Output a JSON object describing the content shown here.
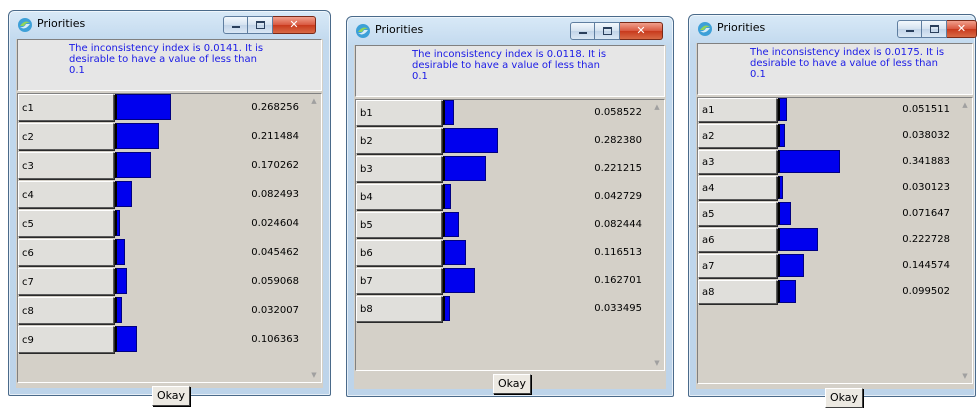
{
  "windows": [
    {
      "title": "Priorities",
      "message": "The inconsistency index is 0.0141.  It is\ndesirable to have a value of less than\n0.1",
      "ok_label": "Okay",
      "close_glyph": "✕",
      "items": [
        {
          "label": "c1",
          "value": "0.268256",
          "weight": 0.268256
        },
        {
          "label": "c2",
          "value": "0.211484",
          "weight": 0.211484
        },
        {
          "label": "c3",
          "value": "0.170262",
          "weight": 0.170262
        },
        {
          "label": "c4",
          "value": "0.082493",
          "weight": 0.082493
        },
        {
          "label": "c5",
          "value": "0.024604",
          "weight": 0.024604
        },
        {
          "label": "c6",
          "value": "0.045462",
          "weight": 0.045462
        },
        {
          "label": "c7",
          "value": "0.059068",
          "weight": 0.059068
        },
        {
          "label": "c8",
          "value": "0.032007",
          "weight": 0.032007
        },
        {
          "label": "c9",
          "value": "0.106363",
          "weight": 0.106363
        }
      ]
    },
    {
      "title": "Priorities",
      "message": "The inconsistency index is 0.0118.  It is\ndesirable to have a value of less than\n0.1",
      "ok_label": "Okay",
      "close_glyph": "✕",
      "items": [
        {
          "label": "b1",
          "value": "0.058522",
          "weight": 0.058522
        },
        {
          "label": "b2",
          "value": "0.282380",
          "weight": 0.28238
        },
        {
          "label": "b3",
          "value": "0.221215",
          "weight": 0.221215
        },
        {
          "label": "b4",
          "value": "0.042729",
          "weight": 0.042729
        },
        {
          "label": "b5",
          "value": "0.082444",
          "weight": 0.082444
        },
        {
          "label": "b6",
          "value": "0.116513",
          "weight": 0.116513
        },
        {
          "label": "b7",
          "value": "0.162701",
          "weight": 0.162701
        },
        {
          "label": "b8",
          "value": "0.033495",
          "weight": 0.033495
        }
      ]
    },
    {
      "title": "Priorities",
      "message": "The inconsistency index is 0.0175.  It is\ndesirable to have a value of less than\n0.1",
      "ok_label": "Okay",
      "close_glyph": "✕",
      "items": [
        {
          "label": "a1",
          "value": "0.051511",
          "weight": 0.051511
        },
        {
          "label": "a2",
          "value": "0.038032",
          "weight": 0.038032
        },
        {
          "label": "a3",
          "value": "0.341883",
          "weight": 0.341883
        },
        {
          "label": "a4",
          "value": "0.030123",
          "weight": 0.030123
        },
        {
          "label": "a5",
          "value": "0.071647",
          "weight": 0.071647
        },
        {
          "label": "a6",
          "value": "0.222728",
          "weight": 0.222728
        },
        {
          "label": "a7",
          "value": "0.144574",
          "weight": 0.144574
        },
        {
          "label": "a8",
          "value": "0.099502",
          "weight": 0.099502
        }
      ]
    }
  ],
  "colors": {
    "bar_fill": "#0000ee",
    "message_text": "#1a1ae6",
    "panel": "#d4d0c8"
  },
  "icons": {
    "app": "app-logo-icon",
    "minimize": "minimize-icon",
    "maximize": "maximize-icon",
    "close": "close-icon",
    "scroll_up": "scroll-up-arrow-icon",
    "scroll_down": "scroll-down-arrow-icon"
  }
}
